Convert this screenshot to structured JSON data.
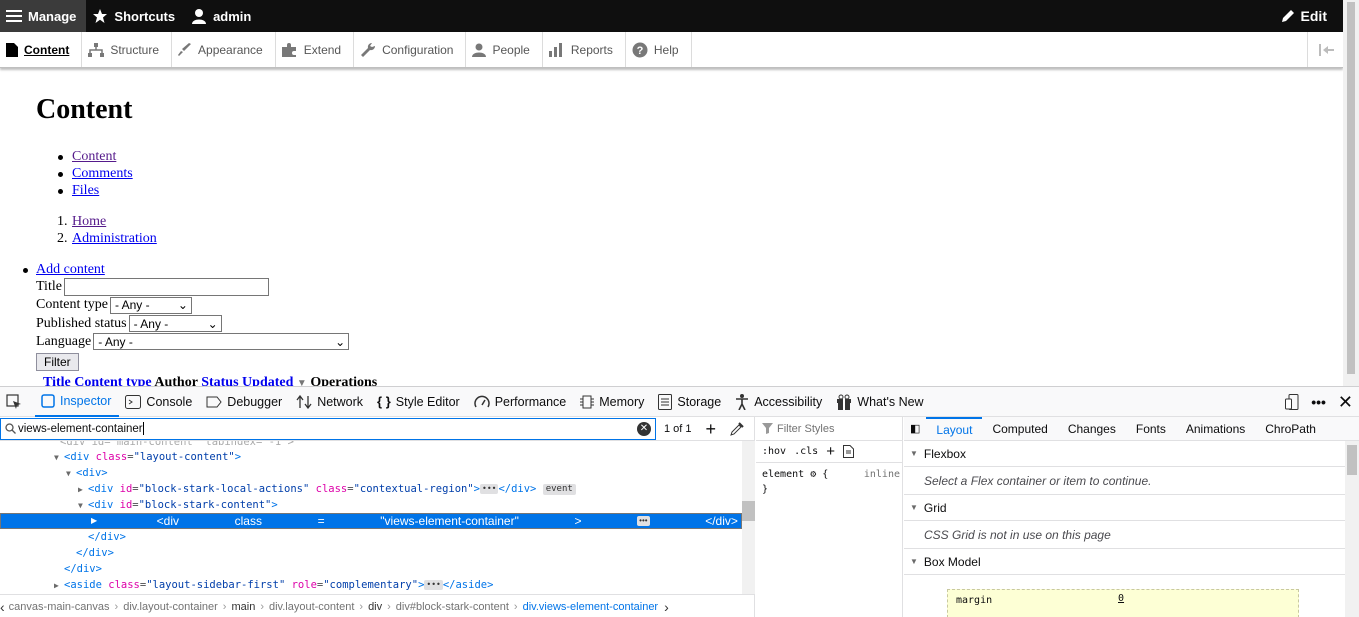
{
  "toolbar": {
    "manage": "Manage",
    "shortcuts": "Shortcuts",
    "user": "admin",
    "edit": "Edit"
  },
  "tray": {
    "items": [
      "Content",
      "Structure",
      "Appearance",
      "Extend",
      "Configuration",
      "People",
      "Reports",
      "Help"
    ]
  },
  "page": {
    "title": "Content",
    "tabs": [
      "Content",
      "Comments",
      "Files"
    ],
    "breadcrumb": [
      "Home",
      "Administration"
    ],
    "action": "Add content",
    "filters": {
      "title_label": "Title",
      "type_label": "Content type",
      "type_value": "- Any -",
      "status_label": "Published status",
      "status_value": "- Any -",
      "lang_label": "Language",
      "lang_value": "- Any -",
      "submit": "Filter"
    },
    "table_headers": [
      "Title",
      "Content type",
      "Author",
      "Status",
      "Updated",
      "Operations"
    ]
  },
  "devtools": {
    "tabs": [
      "Inspector",
      "Console",
      "Debugger",
      "Network",
      "Style Editor",
      "Performance",
      "Memory",
      "Storage",
      "Accessibility",
      "What's New"
    ],
    "search_query": "views-element-container",
    "match_count": "1 of 1",
    "tree": {
      "r1_tag": "div",
      "r1_attr": "class",
      "r1_val": "\"layout-content\"",
      "r2_tag": "div",
      "r3_tag": "div",
      "r3_id": "\"block-stark-local-actions\"",
      "r3_class": "\"contextual-region\"",
      "r3_badge": "event",
      "r4_id": "\"block-stark-content\"",
      "r5_class": "\"views-element-container\"",
      "r10_tag": "aside",
      "r10_class": "\"layout-sidebar-first\"",
      "r10_role": "\"complementary\""
    },
    "breadcrumbs": [
      "canvas-main-canvas",
      "div.layout-container",
      "main",
      "div.layout-content",
      "div",
      "div#block-stark-content",
      "div.views-element-container"
    ],
    "rules": {
      "filter_placeholder": "Filter Styles",
      "hov": ":hov",
      "cls": ".cls",
      "selector": "element",
      "inline": "inline"
    },
    "side_tabs": [
      "Layout",
      "Computed",
      "Changes",
      "Fonts",
      "Animations",
      "ChroPath"
    ],
    "sections": {
      "flexbox": "Flexbox",
      "flexbox_msg": "Select a Flex container or item to continue.",
      "grid": "Grid",
      "grid_msg": "CSS Grid is not in use on this page",
      "box_model": "Box Model",
      "margin_label": "margin",
      "margin_value": "0"
    }
  }
}
